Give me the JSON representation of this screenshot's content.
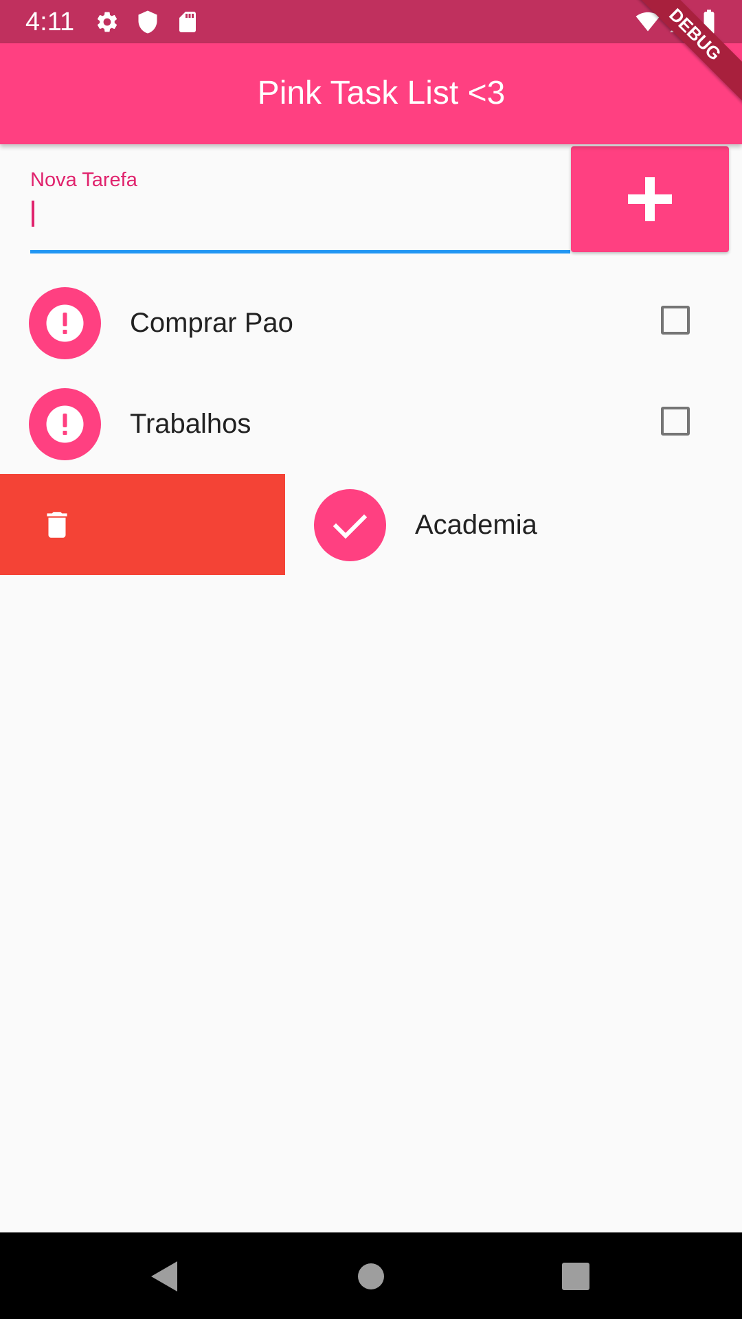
{
  "status_bar": {
    "time": "4:11",
    "left_icons": [
      "gear-icon",
      "shield-icon",
      "sd-card-icon"
    ],
    "right_icons": [
      "wifi-icon",
      "signal-icon",
      "battery-icon"
    ],
    "color": "#c0305e"
  },
  "app_bar": {
    "title": "Pink Task List <3",
    "color": "#ff4081"
  },
  "debug_banner": {
    "label": "DEBUG"
  },
  "new_task": {
    "label": "Nova Tarefa",
    "value": "",
    "add_icon": "plus-icon"
  },
  "tasks": [
    {
      "label": "Comprar Pao",
      "done": false,
      "avatar_icon": "exclamation-icon"
    },
    {
      "label": "Trabalhos",
      "done": false,
      "avatar_icon": "exclamation-icon"
    },
    {
      "label": "Academia",
      "done": true,
      "avatar_icon": "check-icon",
      "swipe_action_icon": "trash-icon"
    }
  ],
  "colors": {
    "accent": "#ff4081",
    "focus_underline": "#2196f3",
    "delete": "#f44336"
  },
  "nav_bar": {
    "icons": [
      "back-icon",
      "home-icon",
      "recents-icon"
    ]
  }
}
